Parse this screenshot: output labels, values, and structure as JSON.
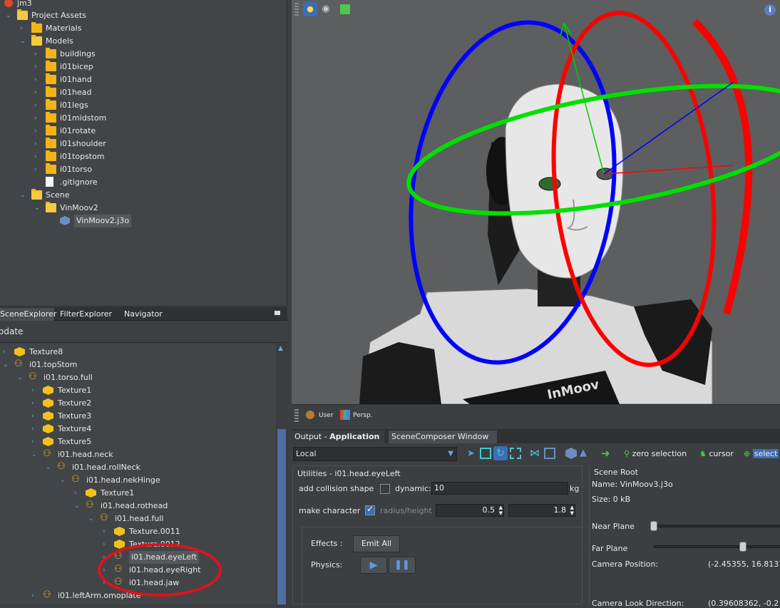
{
  "project_tree": {
    "root_label": "jm3",
    "items": [
      {
        "label": "Project Assets",
        "kind": "folder-open"
      },
      {
        "label": "Materials",
        "kind": "folder"
      },
      {
        "label": "Models",
        "kind": "folder-open"
      },
      {
        "label": "buildings",
        "kind": "folder"
      },
      {
        "label": "i01bicep",
        "kind": "folder"
      },
      {
        "label": "i01hand",
        "kind": "folder"
      },
      {
        "label": "i01head",
        "kind": "folder"
      },
      {
        "label": "i01legs",
        "kind": "folder"
      },
      {
        "label": "i01midstom",
        "kind": "folder"
      },
      {
        "label": "i01rotate",
        "kind": "folder"
      },
      {
        "label": "i01shoulder",
        "kind": "folder"
      },
      {
        "label": "i01topstom",
        "kind": "folder"
      },
      {
        "label": "i01torso",
        "kind": "folder"
      },
      {
        "label": ".gitignore",
        "kind": "file"
      },
      {
        "label": "Scene",
        "kind": "folder-open"
      },
      {
        "label": "VinMoov2",
        "kind": "folder-open"
      },
      {
        "label": "VinMoov2.j3o",
        "kind": "model"
      }
    ]
  },
  "explorer_tabs": [
    "SceneExplorer",
    "FilterExplorer",
    "Navigator"
  ],
  "explorer_toolbar_label": "Update",
  "scene_tree": {
    "items": [
      {
        "label": "Texture8",
        "kind": "geometry"
      },
      {
        "label": "i01.topStom",
        "kind": "node"
      },
      {
        "label": "i01.torso.full",
        "kind": "node"
      },
      {
        "label": "Texture1",
        "kind": "geometry"
      },
      {
        "label": "Texture2",
        "kind": "geometry"
      },
      {
        "label": "Texture3",
        "kind": "geometry"
      },
      {
        "label": "Texture4",
        "kind": "geometry"
      },
      {
        "label": "Texture5",
        "kind": "geometry"
      },
      {
        "label": "i01.head.neck",
        "kind": "node"
      },
      {
        "label": "i01.head.rollNeck",
        "kind": "node"
      },
      {
        "label": "i01.head.nekHinge",
        "kind": "node"
      },
      {
        "label": "Texture1",
        "kind": "geometry"
      },
      {
        "label": "i01.head.rothead",
        "kind": "node"
      },
      {
        "label": "i01.head.full",
        "kind": "node"
      },
      {
        "label": "Texture.0011",
        "kind": "geometry"
      },
      {
        "label": "Texture.0012",
        "kind": "geometry"
      },
      {
        "label": "i01.head.eyeLeft",
        "kind": "node"
      },
      {
        "label": "i01.head.eyeRight",
        "kind": "node"
      },
      {
        "label": "i01.head.jaw",
        "kind": "node"
      },
      {
        "label": "i01.leftArm.omoplate",
        "kind": "node"
      }
    ]
  },
  "viewport": {
    "bottom_buttons": {
      "user": "User",
      "persp": "Persp."
    },
    "gizmo_colors": {
      "x": "#ff0000",
      "y": "#00e000",
      "z": "#0000ff"
    }
  },
  "bottom_tabs": {
    "output_prefix": "Output - ",
    "output_bold": "Application",
    "composer": "SceneComposer Window"
  },
  "composer_toolbar": {
    "mode_select": "Local",
    "zero_selection": "zero selection",
    "cursor": "cursor",
    "select": "select"
  },
  "utilities": {
    "title": "Utilities - i01.head.eyeLeft",
    "add_collision_shape": "add collision shape",
    "dynamic_label": "dynamic:",
    "dynamic_value": "10",
    "unit": "kg",
    "make_character": "make character",
    "radius_height_label": "radius/height",
    "radius_value": "0.5",
    "height_value": "1.8",
    "effects_label": "Effects :",
    "emit_all": "Emit All",
    "physics_label": "Physics:"
  },
  "scene_root": {
    "title": "Scene Root",
    "name": "Name: VinMoov3.j3o",
    "size": "Size: 0 kB",
    "near_plane": "Near Plane",
    "far_plane": "Far Plane",
    "camera_position_label": "Camera Position:",
    "camera_position_value": "(-2.45355, 16.8137",
    "camera_look_label": "Camera Look Direction:",
    "camera_look_value": "(0.39608362, -0.2"
  }
}
